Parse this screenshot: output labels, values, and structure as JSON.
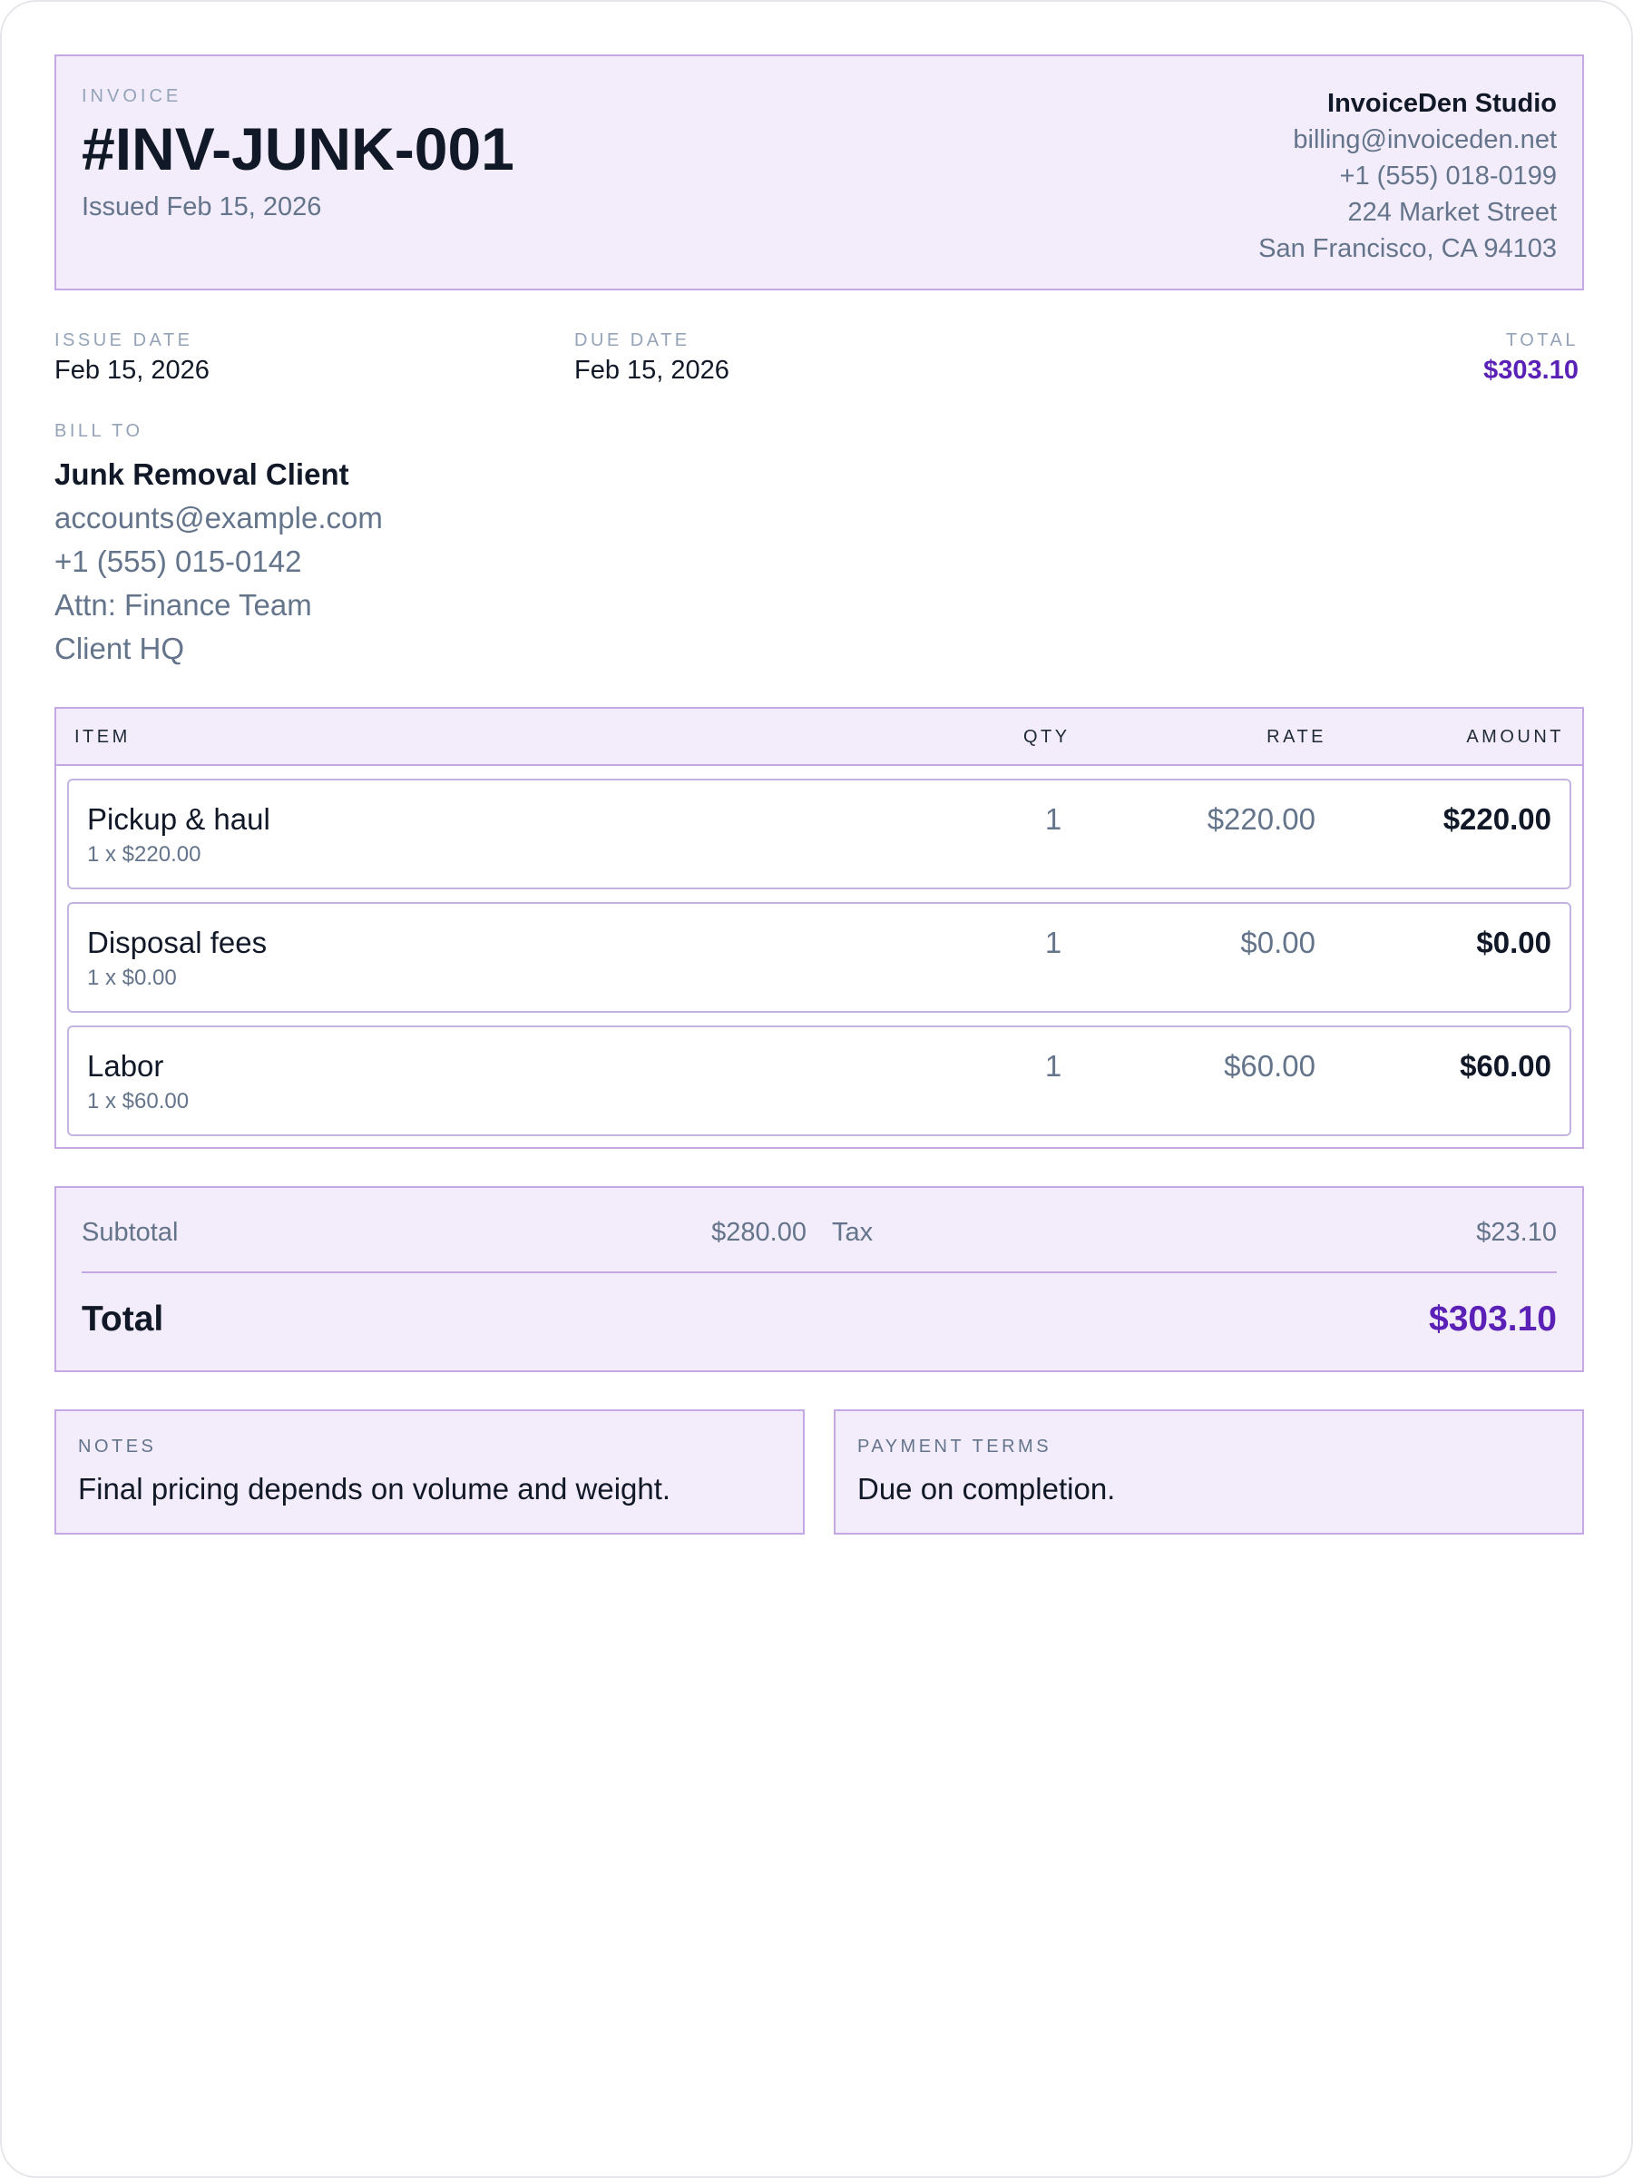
{
  "header": {
    "label": "INVOICE",
    "invoice_number": "#INV-JUNK-001",
    "issued": "Issued Feb 15, 2026"
  },
  "company": {
    "name": "InvoiceDen Studio",
    "email": "billing@invoiceden.net",
    "phone": "+1 (555) 018-0199",
    "street": "224 Market Street",
    "city": "San Francisco, CA 94103"
  },
  "meta": {
    "issue_date_label": "ISSUE DATE",
    "issue_date": "Feb 15, 2026",
    "due_date_label": "DUE DATE",
    "due_date": "Feb 15, 2026",
    "total_label": "TOTAL",
    "total": "$303.10"
  },
  "bill_to": {
    "label": "BILL TO",
    "name": "Junk Removal Client",
    "email": "accounts@example.com",
    "phone": "+1 (555) 015-0142",
    "attn": "Attn: Finance Team",
    "location": "Client HQ"
  },
  "items": {
    "headers": {
      "item": "ITEM",
      "qty": "QTY",
      "rate": "RATE",
      "amount": "AMOUNT"
    },
    "rows": [
      {
        "name": "Pickup & haul",
        "detail": "1 x $220.00",
        "qty": "1",
        "rate": "$220.00",
        "amount": "$220.00"
      },
      {
        "name": "Disposal fees",
        "detail": "1 x $0.00",
        "qty": "1",
        "rate": "$0.00",
        "amount": "$0.00"
      },
      {
        "name": "Labor",
        "detail": "1 x $60.00",
        "qty": "1",
        "rate": "$60.00",
        "amount": "$60.00"
      }
    ]
  },
  "totals": {
    "subtotal_label": "Subtotal",
    "subtotal": "$280.00",
    "tax_label": "Tax",
    "tax": "$23.10",
    "total_label": "Total",
    "total": "$303.10"
  },
  "notes": {
    "label": "NOTES",
    "text": "Final pricing depends on volume and weight."
  },
  "payment_terms": {
    "label": "PAYMENT TERMS",
    "text": "Due on completion."
  },
  "colors": {
    "accent": "#5b21b6",
    "panel_bg": "#f3edfb",
    "panel_border": "#c4a8e4"
  }
}
